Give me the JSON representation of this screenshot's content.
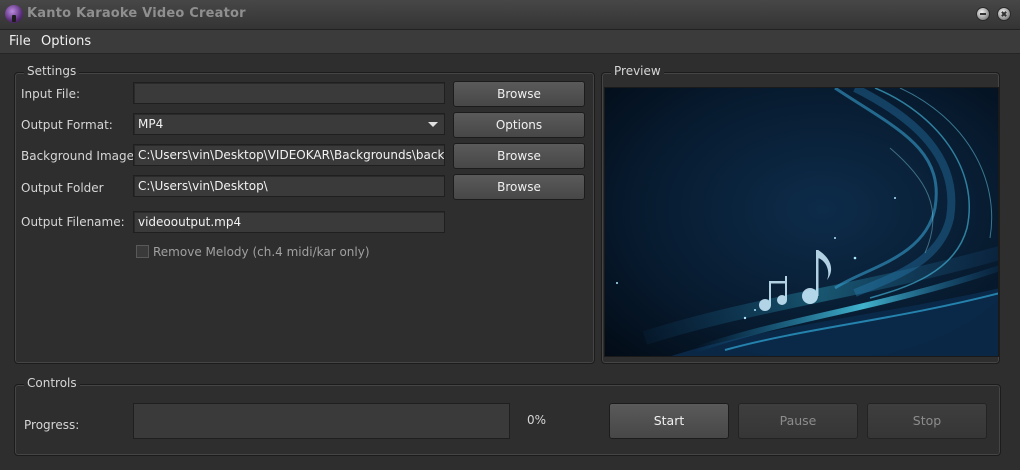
{
  "window": {
    "title": "Kanto Karaoke Video Creator",
    "icon": "karaoke-microphone-icon",
    "controls": [
      "minimize-icon",
      "close-icon"
    ]
  },
  "menu": {
    "items": [
      "File",
      "Options"
    ]
  },
  "settings": {
    "group_label": "Settings",
    "input_file": {
      "label": "Input File:",
      "value": "",
      "button": "Browse"
    },
    "output_format": {
      "label": "Output Format:",
      "value": "MP4",
      "button": "Options"
    },
    "background_image": {
      "label": "Background Image:",
      "value": "C:\\Users\\vin\\Desktop\\VIDEOKAR\\Backgrounds\\backgrou",
      "button": "Browse"
    },
    "output_folder": {
      "label": "Output Folder",
      "value": "C:\\Users\\vin\\Desktop\\",
      "button": "Browse"
    },
    "output_filename": {
      "label": "Output Filename:",
      "value": "videooutput.mp4"
    },
    "remove_melody": {
      "label": "Remove Melody (ch.4 midi/kar only)",
      "checked": false
    }
  },
  "preview": {
    "group_label": "Preview",
    "image": "dark-blue-wave-music-notes-background"
  },
  "controls": {
    "group_label": "Controls",
    "progress_label": "Progress:",
    "progress_value": 0,
    "progress_text": "0%",
    "start": "Start",
    "pause": "Pause",
    "stop": "Stop"
  },
  "colors": {
    "window_bg": "#2e2e2e",
    "field_bg": "#3a3a3a",
    "preview_bg": "#05101e",
    "wave_cyan": "#39c8e6"
  }
}
